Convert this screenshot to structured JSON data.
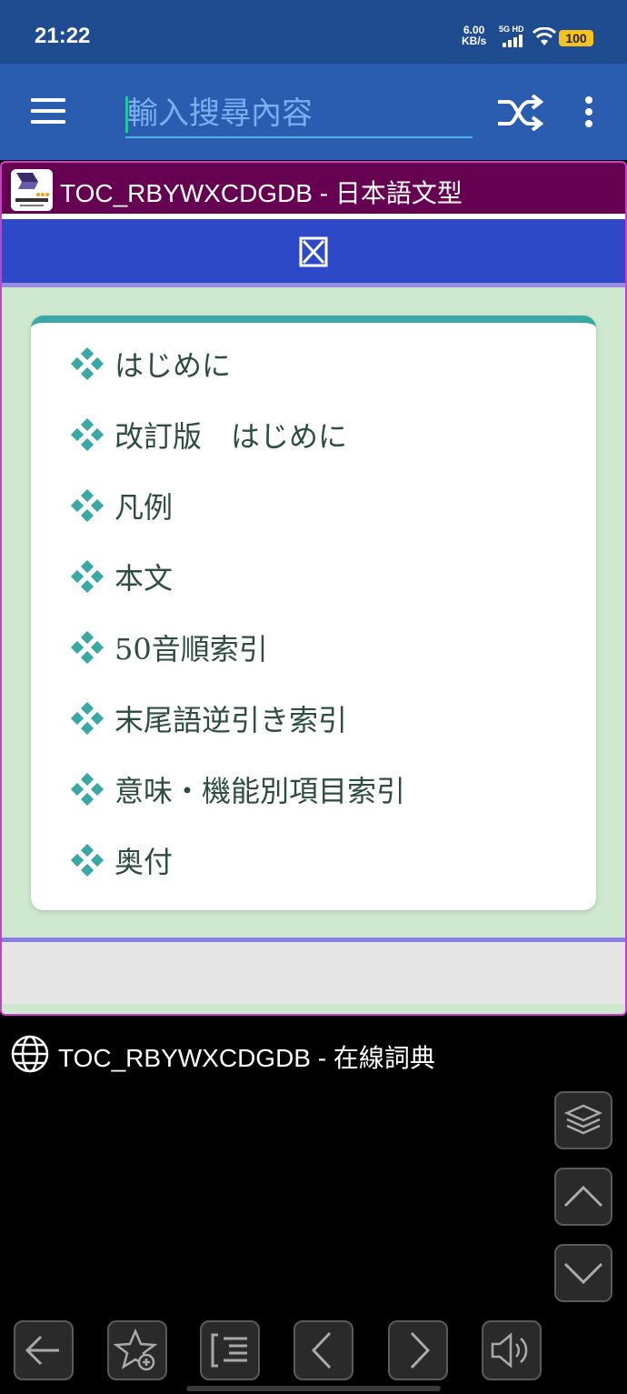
{
  "status_bar": {
    "time": "21:22",
    "speed_value": "6.00",
    "speed_unit": "KB/s",
    "network": "5G HD",
    "battery": "100"
  },
  "toolbar": {
    "search_placeholder": "輸入搜尋內容",
    "menu_icon": "hamburger-menu-icon",
    "shuffle_icon": "shuffle-icon",
    "more_icon": "more-vert-icon"
  },
  "dictionary_panel": {
    "title": "TOC_RBYWXCDGDB - 日本語文型",
    "close_glyph": "⊠",
    "toc_items": [
      "はじめに",
      "改訂版　はじめに",
      "凡例",
      "本文",
      "50音順索引",
      "末尾語逆引き索引",
      "意味・機能別項目索引",
      "奥付"
    ]
  },
  "online_section": {
    "title": "TOC_RBYWXCDGDB - 在線詞典"
  },
  "colors": {
    "status_bar": "#1f4c91",
    "toolbar": "#2a5db0",
    "panel_header": "#660050",
    "blue_bar": "#2d49c8",
    "panel_bg": "#cfe8d0",
    "card_accent": "#3aa8a4"
  }
}
